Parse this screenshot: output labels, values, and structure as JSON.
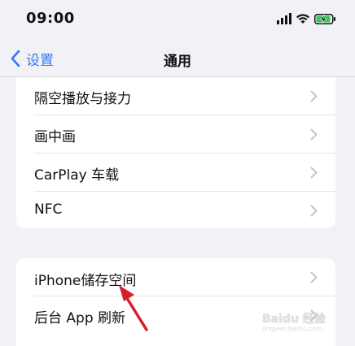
{
  "status_bar": {
    "time": "09:00",
    "icons": [
      "signal-icon",
      "wifi-icon",
      "battery-charging-icon"
    ]
  },
  "nav": {
    "back_label": "设置",
    "title": "通用"
  },
  "groups": [
    {
      "items": [
        {
          "label": "隔空播放与接力"
        },
        {
          "label": "画中画"
        },
        {
          "label": "CarPlay 车载"
        },
        {
          "label": "NFC"
        }
      ]
    },
    {
      "items": [
        {
          "label": "iPhone储存空间"
        },
        {
          "label": "后台 App 刷新"
        }
      ]
    }
  ],
  "annotation": {
    "color": "#d6202a"
  },
  "colors": {
    "accent": "#2f7bf5",
    "background": "#f2f2f6",
    "chevron": "#c4c4c7"
  },
  "watermark": {
    "logo_text": "Baidu 经验",
    "sub_text": "jingyan.baidu.com"
  }
}
